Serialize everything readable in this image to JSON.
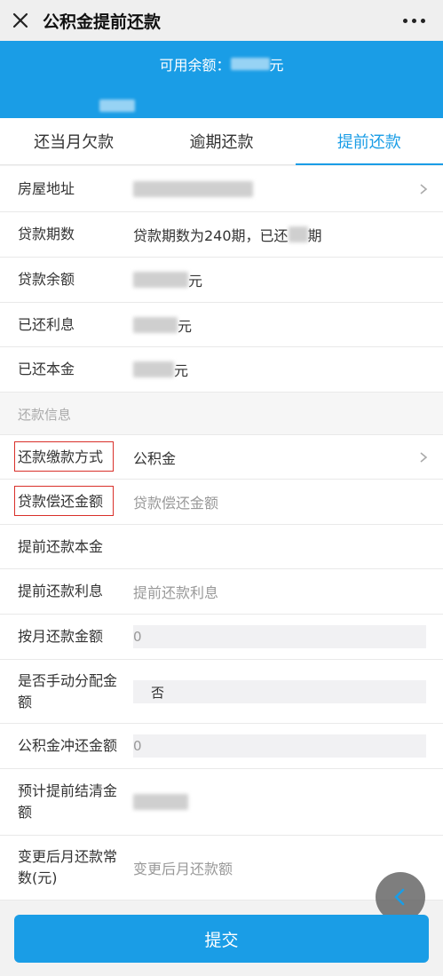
{
  "header": {
    "title": "公积金提前还款"
  },
  "banner": {
    "balance_label": "可用余额：",
    "balance_unit": "元"
  },
  "tabs": [
    {
      "label": "还当月欠款"
    },
    {
      "label": "逾期还款"
    },
    {
      "label": "提前还款"
    }
  ],
  "info": {
    "address_label": "房屋地址",
    "term_label": "贷款期数",
    "term_value_prefix": "贷款期数为240期，已还",
    "term_value_suffix": "期",
    "balance_label": "贷款余额",
    "balance_unit": "元",
    "interest_paid_label": "已还利息",
    "interest_paid_unit": "元",
    "principal_paid_label": "已还本金",
    "principal_paid_unit": "元"
  },
  "section": {
    "title": "还款信息"
  },
  "form": {
    "payment_method_label": "还款缴款方式",
    "payment_method_value": "公积金",
    "repay_amount_label": "贷款偿还金额",
    "repay_amount_placeholder": "贷款偿还金额",
    "prepay_principal_label": "提前还款本金",
    "prepay_interest_label": "提前还款利息",
    "prepay_interest_placeholder": "提前还款利息",
    "monthly_amount_label": "按月还款金额",
    "monthly_amount_value": "0",
    "manual_alloc_label": "是否手动分配金额",
    "manual_alloc_value": "否",
    "fund_offset_label": "公积金冲还金额",
    "fund_offset_value": "0",
    "estimated_settle_label": "预计提前结清金额",
    "changed_monthly_label": "变更后月还款常数(元)",
    "changed_monthly_placeholder": "变更后月还款额"
  },
  "actions": {
    "submit_label": "提交"
  },
  "colors": {
    "accent": "#1a9de6",
    "highlight_border": "#d9302a"
  }
}
